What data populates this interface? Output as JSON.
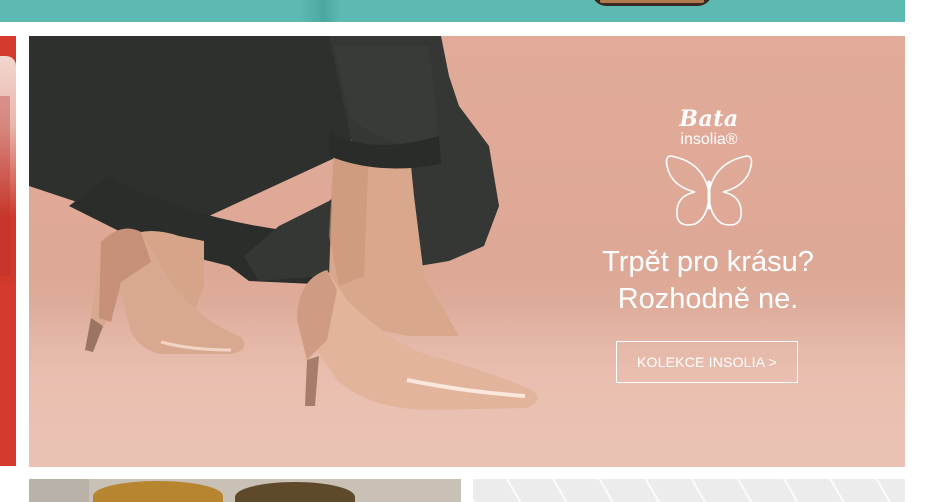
{
  "hero": {
    "brand_name": "Bata",
    "brand_sub": "insolia®",
    "headline_line1": "Trpět pro krásu?",
    "headline_line2": "Rozhodně ne.",
    "cta_label": "KOLEKCE INSOLIA >",
    "icon": "butterfly-icon",
    "background_color": "#dea896",
    "text_color": "#ffffff"
  },
  "top_banner": {
    "background_color": "#5cbab2"
  },
  "left_panel": {
    "background_color": "#d63a2e"
  }
}
